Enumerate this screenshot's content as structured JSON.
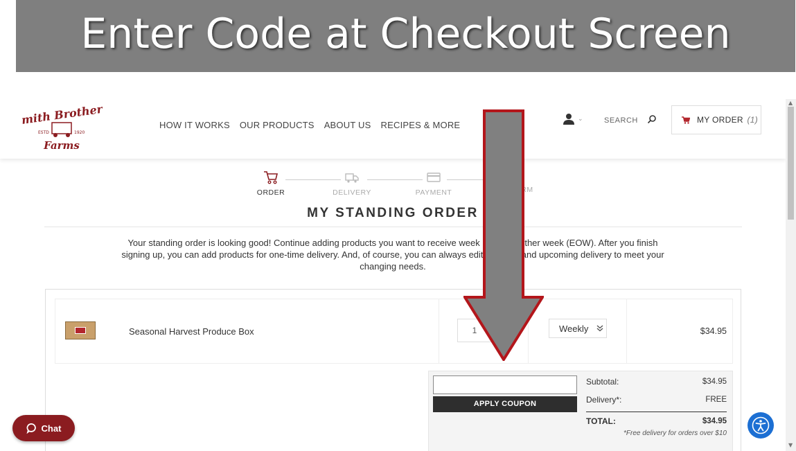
{
  "banner": {
    "title": "Enter Code at Checkout Screen"
  },
  "logo": {
    "line1": "Smith Brothers",
    "estd": "ESTD",
    "year": "1920",
    "line2": "Farms"
  },
  "nav": {
    "items": [
      "HOW IT WORKS",
      "OUR PRODUCTS",
      "ABOUT US",
      "RECIPES & MORE"
    ]
  },
  "header": {
    "search_label": "SEARCH",
    "order_label": "MY ORDER",
    "order_count": "(1)"
  },
  "steps": [
    {
      "label": "ORDER",
      "icon": "cart-icon",
      "active": true
    },
    {
      "label": "DELIVERY",
      "icon": "truck-icon",
      "active": false
    },
    {
      "label": "PAYMENT",
      "icon": "card-icon",
      "active": false
    },
    {
      "label": "RM",
      "icon": "check-icon",
      "active": false
    }
  ],
  "page": {
    "title": "MY STANDING ORDER",
    "intro_line1": "Your standing order is looking good! Continue adding products you want to receive week",
    "intro_line1b": "y other week (EOW). After you finish",
    "intro_line2": "signing up, you can add products for one-time delivery. And, of course, you can always edit",
    "intro_line2b": "r and upcoming delivery to meet your",
    "intro_line3": "changing needs."
  },
  "cart": {
    "items": [
      {
        "name": "Seasonal Harvest Produce Box",
        "qty": "1",
        "frequency": "Weekly",
        "price": "$34.95"
      }
    ]
  },
  "summary": {
    "coupon_placeholder": "",
    "apply_label": "APPLY COUPON",
    "subtotal_label": "Subtotal:",
    "subtotal_value": "$34.95",
    "delivery_label": "Delivery*:",
    "delivery_value": "FREE",
    "total_label": "TOTAL:",
    "total_value": "$34.95",
    "note": "*Free delivery for orders over $10"
  },
  "chat": {
    "label": "Chat"
  },
  "colors": {
    "brand": "#8b1c20",
    "banner": "#7f7f7f",
    "arrow_fill": "#808080",
    "arrow_stroke": "#b3161b",
    "a11y": "#1c6fd3"
  }
}
